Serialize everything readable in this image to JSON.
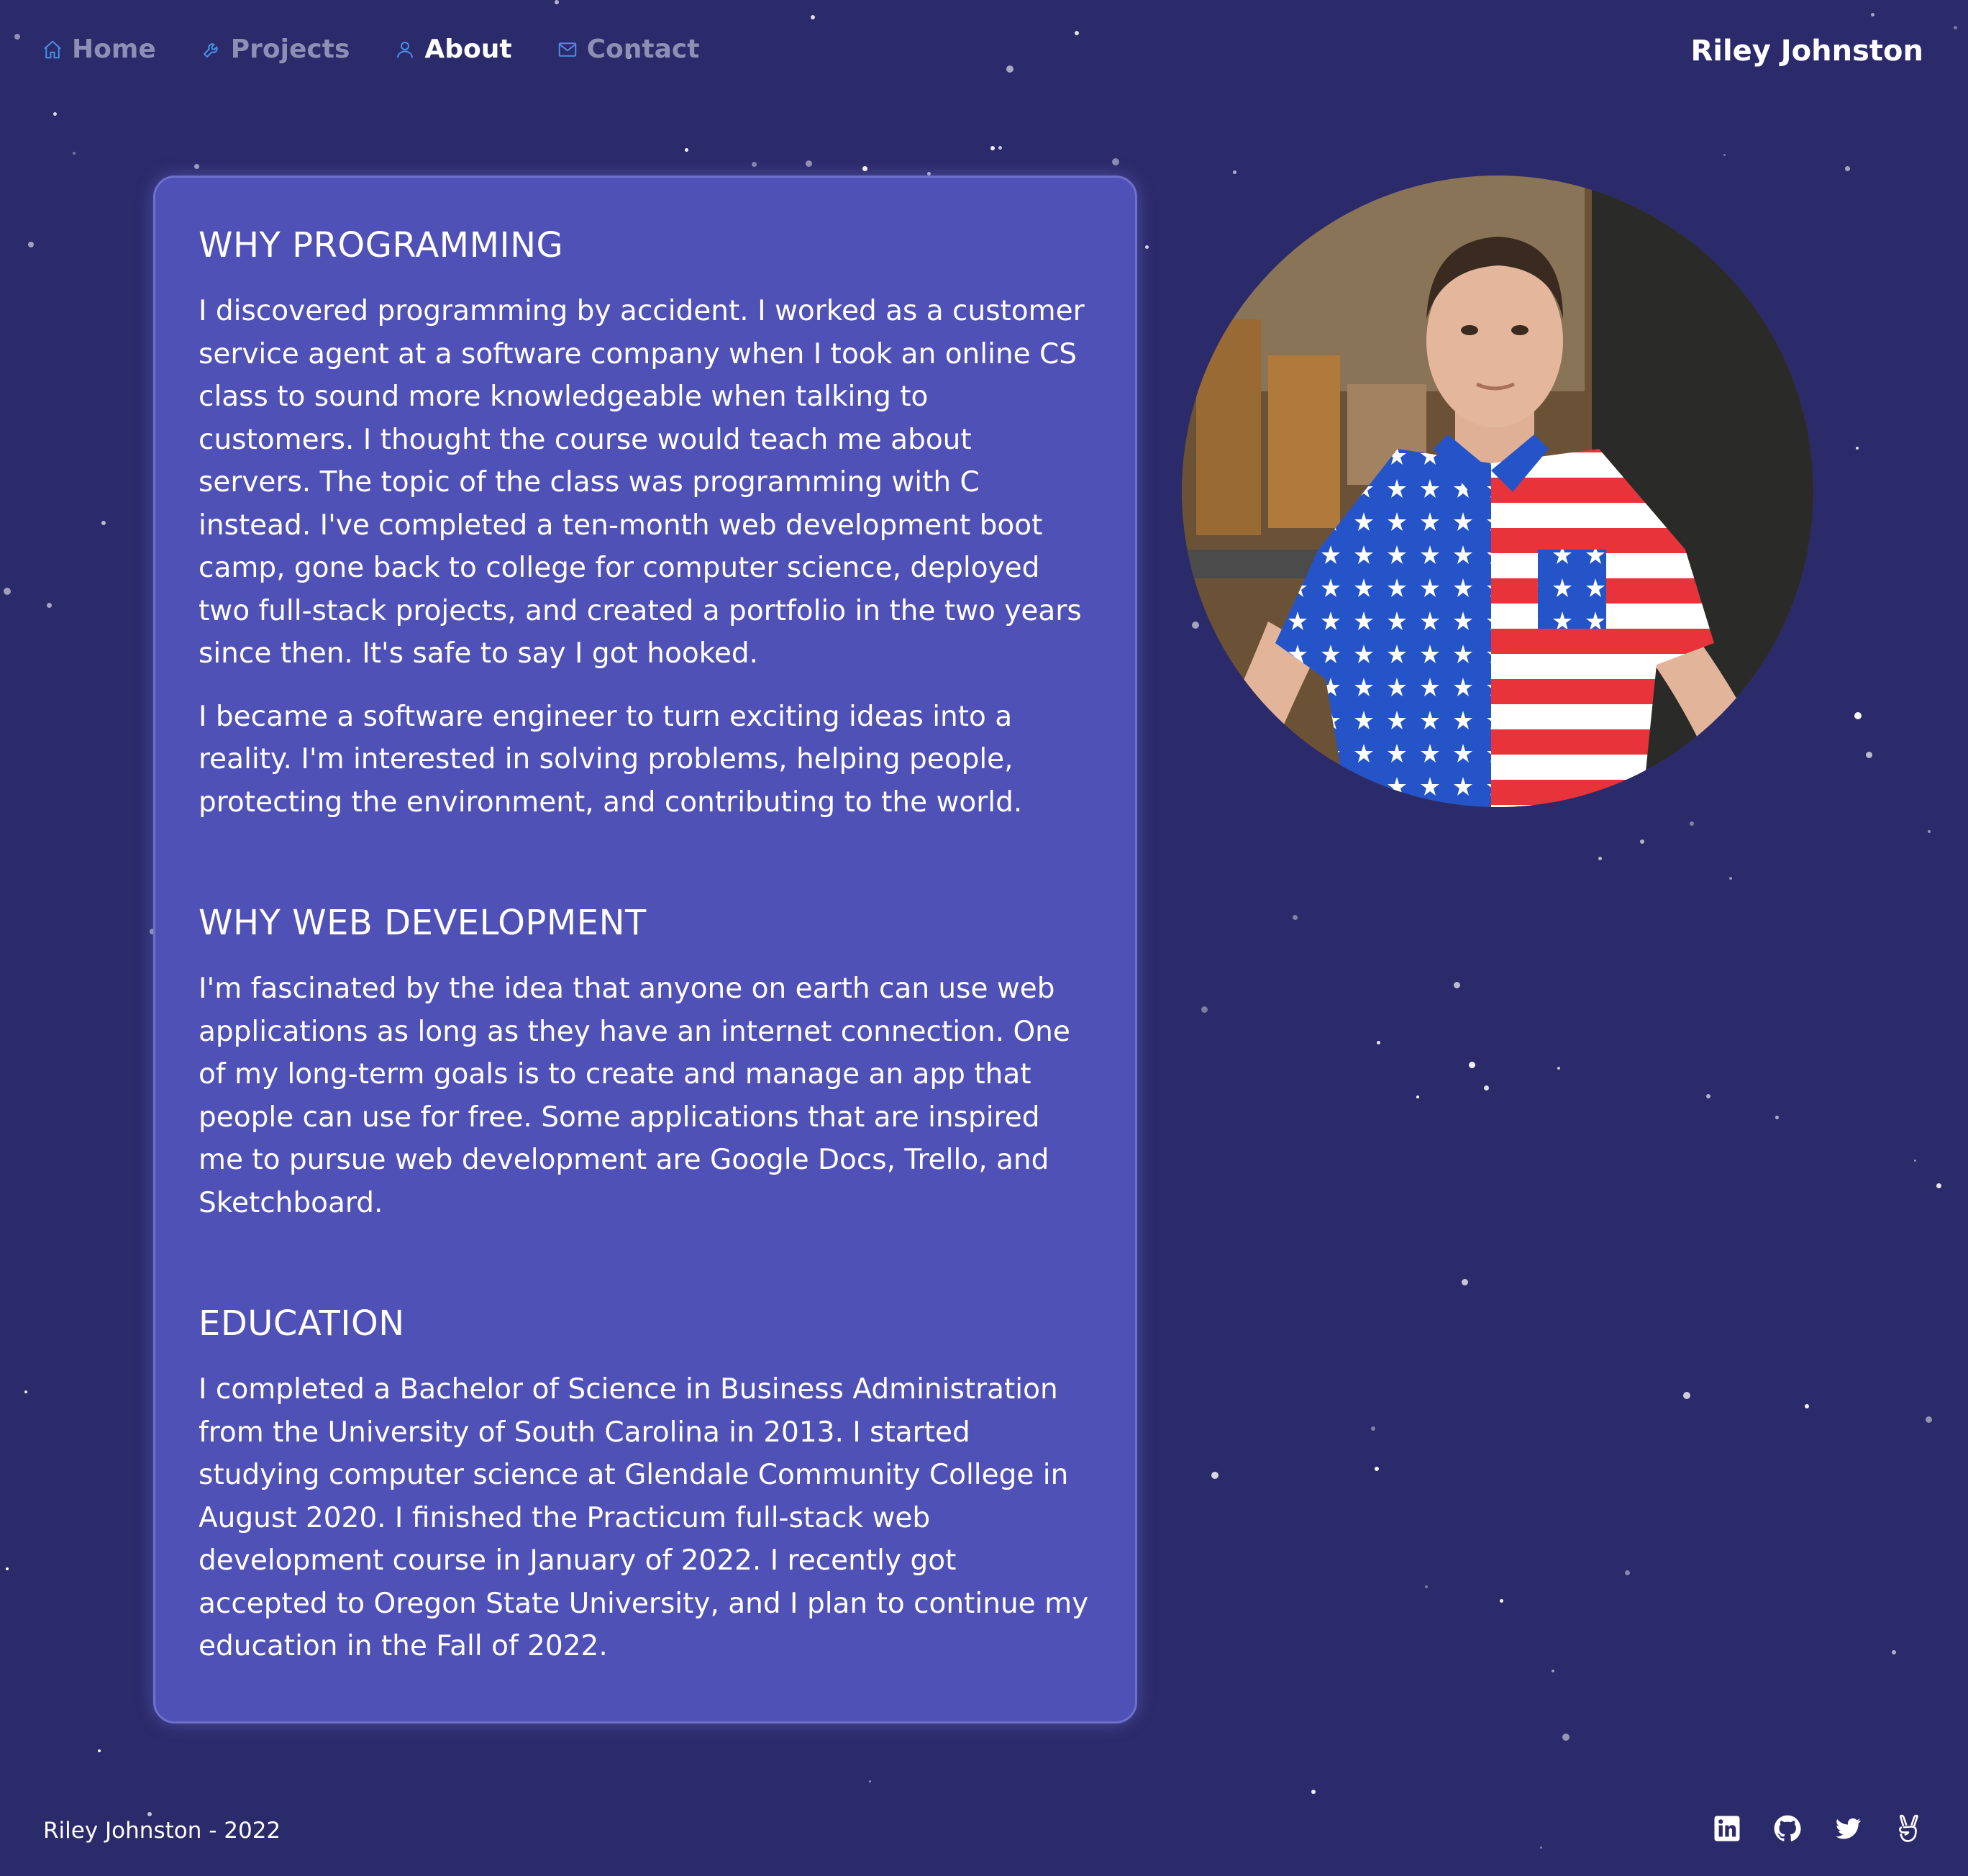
{
  "nav": {
    "items": [
      {
        "label": "Home",
        "icon": "home-icon",
        "active": false
      },
      {
        "label": "Projects",
        "icon": "wrench-icon",
        "active": false
      },
      {
        "label": "About",
        "icon": "user-icon",
        "active": true
      },
      {
        "label": "Contact",
        "icon": "mail-icon",
        "active": false
      }
    ],
    "brand": "Riley Johnston"
  },
  "about": {
    "sections": [
      {
        "title": "WHY PROGRAMMING",
        "paragraphs": [
          "I discovered programming by accident. I worked as a customer service agent at a software company when I took an online CS class to sound more knowledgeable when talking to customers. I thought the course would teach me about servers. The topic of the class was programming with C instead. I've completed a ten-month web development boot camp, gone back to college for computer science, deployed two full-stack projects, and created a portfolio in the two years since then. It's safe to say I got hooked.",
          "I became a software engineer to turn exciting ideas into a reality. I'm interested in solving problems, helping people, protecting the environment, and contributing to the world."
        ]
      },
      {
        "title": "WHY WEB DEVELOPMENT",
        "paragraphs": [
          "I'm fascinated by the idea that anyone on earth can use web applications as long as they have an internet connection. One of my long-term goals is to create and manage an app that people can use for free. Some applications that are inspired me to pursue web development are Google Docs, Trello, and Sketchboard."
        ]
      },
      {
        "title": "EDUCATION",
        "paragraphs": [
          "I completed a Bachelor of Science in Business Administration from the University of South Carolina in 2013. I started studying computer science at Glendale Community College in August 2020. I finished the Practicum full-stack web development course in January of 2022. I recently got accepted to Oregon State University, and I plan to continue my education in the Fall of 2022."
        ]
      }
    ]
  },
  "footer": {
    "text": "Riley Johnston - 2022",
    "socials": [
      "linkedin-icon",
      "github-icon",
      "twitter-icon",
      "angellist-icon"
    ]
  },
  "colors": {
    "background": "#2b2a6b",
    "card": "#4f51b6",
    "nav_inactive": "#8d8fb4",
    "nav_active": "#ffffff",
    "icon_accent": "#4a90e2"
  }
}
